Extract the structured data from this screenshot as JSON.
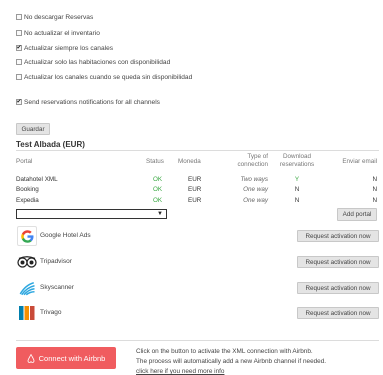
{
  "options": [
    {
      "label": "No descargar Reservas",
      "checked": false
    },
    {
      "label": "No actualizar el inventario",
      "checked": false
    },
    {
      "label": "Actualizar siempre los canales",
      "checked": true
    },
    {
      "label": "Actualizar solo las habitaciones con disponibilidad",
      "checked": false
    },
    {
      "label": "Actualizar los canales cuando se queda sin disponibilidad",
      "checked": false
    }
  ],
  "notifications_option": {
    "label": "Send reservations notifications for all channels",
    "checked": true
  },
  "save_button": "Guardar",
  "section_title": "Test Albada (EUR)",
  "table": {
    "headers": {
      "portal": "Portal",
      "status": "Status",
      "currency": "Moneda",
      "connection_type_1": "Type of",
      "connection_type_2": "connection",
      "download_1": "Download",
      "download_2": "reservations",
      "send_email": "Enviar email"
    },
    "rows": [
      {
        "portal": "Datahotel XML",
        "status": "OK",
        "currency": "EUR",
        "connection": "Two ways",
        "download": "Y",
        "email": "N"
      },
      {
        "portal": "Booking",
        "status": "OK",
        "currency": "EUR",
        "connection": "One way",
        "download": "N",
        "email": "N"
      },
      {
        "portal": "Expedia",
        "status": "OK",
        "currency": "EUR",
        "connection": "One way",
        "download": "N",
        "email": "N"
      }
    ]
  },
  "portal_select": {
    "value": "",
    "arrow": "▼"
  },
  "add_portal_button": "Add portal",
  "providers": [
    {
      "name": "Google Hotel Ads",
      "button": "Request activation now",
      "icon": "google-icon"
    },
    {
      "name": "Tripadvisor",
      "button": "Request activation now",
      "icon": "tripadvisor-icon"
    },
    {
      "name": "Skyscanner",
      "button": "Request activation now",
      "icon": "skyscanner-icon"
    },
    {
      "name": "Trivago",
      "button": "Request activation now",
      "icon": "trivago-icon"
    }
  ],
  "airbnb": {
    "button": "Connect with Airbnb",
    "icon": "airbnb-icon",
    "line1": "Click on the button to activate the XML connection with Airbnb.",
    "line2": "The process will automatically add a new Airbnb channel if needed.",
    "line3": "click here if you need more info"
  },
  "colors": {
    "ok": "#3aa843",
    "airbnb": "#f05c5f",
    "button_bg": "#e4e4e4"
  }
}
